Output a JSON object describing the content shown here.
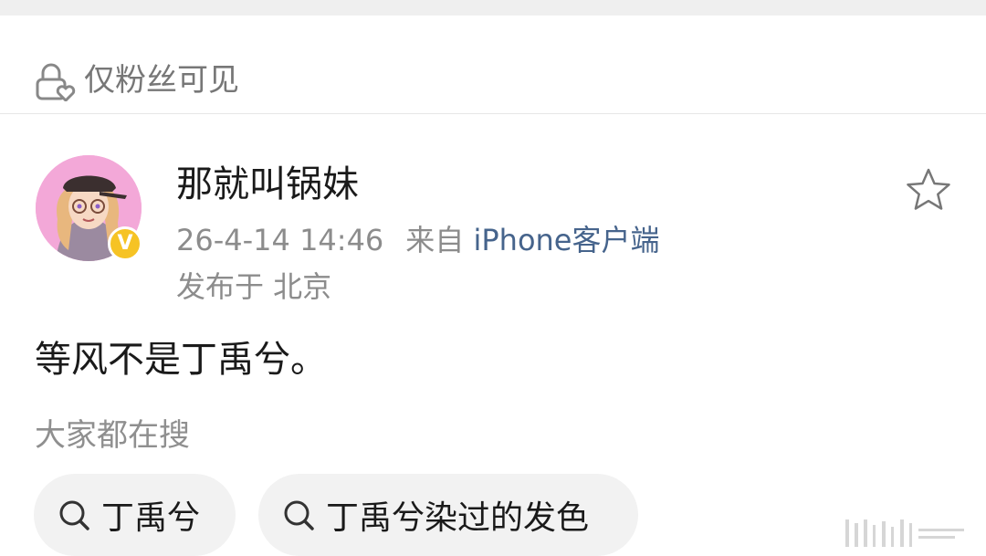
{
  "visibility": {
    "icon": "lock-heart-icon",
    "label": "仅粉丝可见"
  },
  "post": {
    "author": {
      "name": "那就叫锅妹",
      "avatar": "cartoon-girl-avatar",
      "verified_badge": "V",
      "badge_color": "#f6c324"
    },
    "timestamp": "26-4-14 14:46",
    "source_prefix": "来自",
    "source": "iPhone客户端",
    "location": "发布于 北京",
    "body": "等风不是丁禹兮。",
    "favorite_icon": "star-icon"
  },
  "search": {
    "heading": "大家都在搜",
    "chips": [
      {
        "icon": "search-icon",
        "label": "丁禹兮"
      },
      {
        "icon": "search-icon",
        "label": "丁禹兮染过的发色"
      }
    ]
  },
  "colors": {
    "link": "#46648c",
    "meta": "#8c8c8c",
    "chip_bg": "#f2f2f2"
  }
}
